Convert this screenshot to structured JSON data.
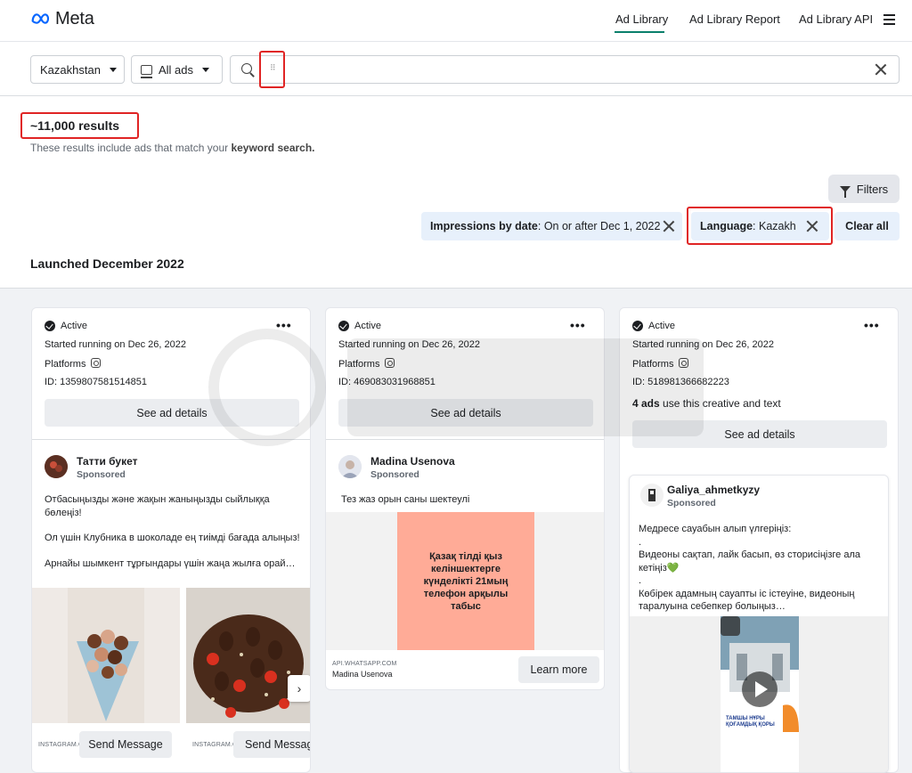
{
  "header": {
    "logo_text": "Meta",
    "nav": [
      {
        "label": "Ad Library",
        "active": true
      },
      {
        "label": "Ad Library Report",
        "active": false
      },
      {
        "label": "Ad Library API",
        "active": false
      }
    ],
    "menu_icon": "hamburger-icon"
  },
  "search": {
    "country": "Kazakhstan",
    "ad_type": "All ads",
    "query": "",
    "clear_icon": "close-icon"
  },
  "results": {
    "count": "~11,000 results",
    "note_prefix": "These results include ads that match your ",
    "note_bold": "keyword search."
  },
  "filters": {
    "button_label": "Filters",
    "chips": [
      {
        "key": "Impressions by date",
        "value": ": On or after Dec 1, 2022"
      },
      {
        "key": "Language",
        "value": ": Kazakh"
      }
    ],
    "clear_all": "Clear all"
  },
  "section_title": "Launched December 2022",
  "colors": {
    "accent": "#0a7f6b",
    "chip_bg": "#e7f0fb",
    "highlight": "#e02424"
  },
  "ads": [
    {
      "status": "Active",
      "started": "Started running on Dec 26, 2022",
      "platforms_label": "Platforms",
      "id": "ID: 1359807581514851",
      "see_details": "See ad details",
      "page_name": "Татти букет",
      "sponsored": "Sponsored",
      "text": [
        "Отбасыңызды және жақын жаныңызды сыйлыққа бөлеңіз!",
        "Ол үшін Клубника в шоколаде ең тиімді бағада алыңыз!",
        "Арнайы шымкент тұрғындары үшін жаңа жылға орай…"
      ],
      "carousel": [
        {
          "source": "INSTAGRAM.COM",
          "cta": "Send Message"
        },
        {
          "source": "INSTAGRAM.COM",
          "cta": "Send Message"
        }
      ]
    },
    {
      "status": "Active",
      "started": "Started running on Dec 26, 2022",
      "platforms_label": "Platforms",
      "id": "ID: 469083031968851",
      "see_details": "See ad details",
      "page_name": "Madina Usenova",
      "sponsored": "Sponsored",
      "text": [
        "Тез жаз орын саны шектеулі"
      ],
      "creative_text": "Қазақ тілді қыз келіншектерге күнделікті 21мың телефон арқылы табыс",
      "link_domain": "API.WHATSAPP.COM",
      "link_title": "Madina Usenova",
      "cta": "Learn more"
    },
    {
      "status": "Active",
      "started": "Started running on Dec 26, 2022",
      "platforms_label": "Platforms",
      "id": "ID: 518981366682223",
      "multi_bold": "4 ads",
      "multi_rest": " use this creative and text",
      "see_details": "See ad details",
      "page_name": "Galiya_ahmetkyzy",
      "sponsored": "Sponsored",
      "text": [
        "Медресе сауабын алып үлгеріңіз:",
        ".",
        "Видеоны сақтап, лайк басып, өз сторисіңізге ала кетіңіз💚",
        ".",
        "Көбірек адамның сауапты іс істеуіне, видеоның таралуына себепкер болыңыз…"
      ],
      "video_caption": "ТАМШЫ НҰРЫ ҚОҒАМДЫҚ ҚОРЫ"
    }
  ]
}
